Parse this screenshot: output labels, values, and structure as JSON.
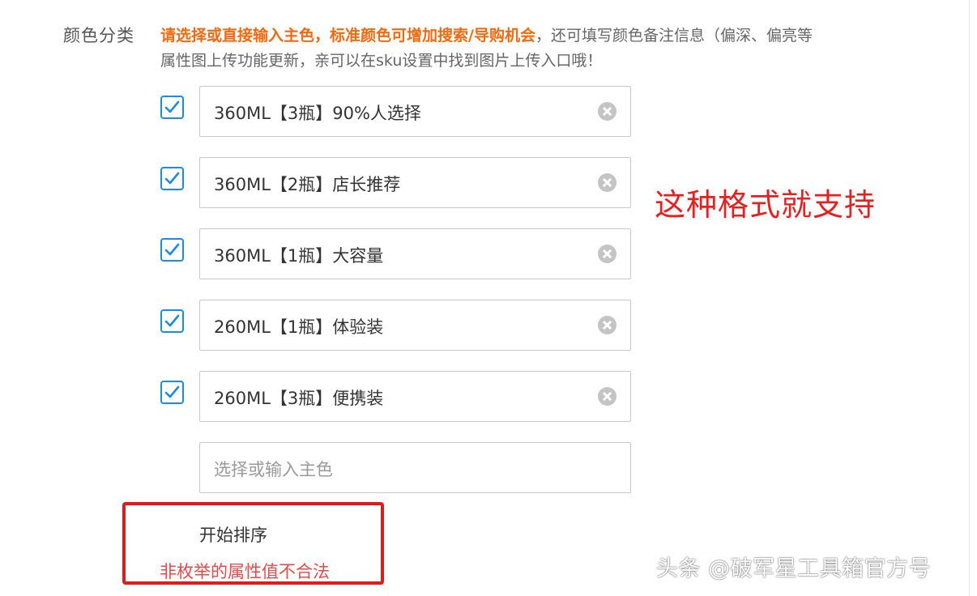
{
  "field": {
    "label": "颜色分类"
  },
  "hint": {
    "emphasis": "请选择或直接输入主色，标准颜色可增加搜索/导购机会",
    "rest_line1": "，还可填写颜色备注信息（偏深、偏亮等",
    "line2": "属性图上传功能更新，亲可以在sku设置中找到图片上传入口哦！"
  },
  "colors": {
    "accent": "#1a8ce6",
    "emphasis": "#f26a10",
    "annotation": "#e62020",
    "error": "#e24b4b"
  },
  "options": [
    {
      "label": "360ML【3瓶】90%人选择",
      "checked": true
    },
    {
      "label": "360ML【2瓶】店长推荐",
      "checked": true
    },
    {
      "label": "360ML【1瓶】大容量",
      "checked": true
    },
    {
      "label": "260ML【1瓶】体验装",
      "checked": true
    },
    {
      "label": "260ML【3瓶】便携装",
      "checked": true
    }
  ],
  "new_option": {
    "placeholder": "选择或输入主色"
  },
  "annotation": {
    "text": "这种格式就支持"
  },
  "sort": {
    "button_label": "开始排序",
    "error": "非枚举的属性值不合法"
  },
  "watermark": {
    "text": "头条 @破军星工具箱官方号"
  }
}
